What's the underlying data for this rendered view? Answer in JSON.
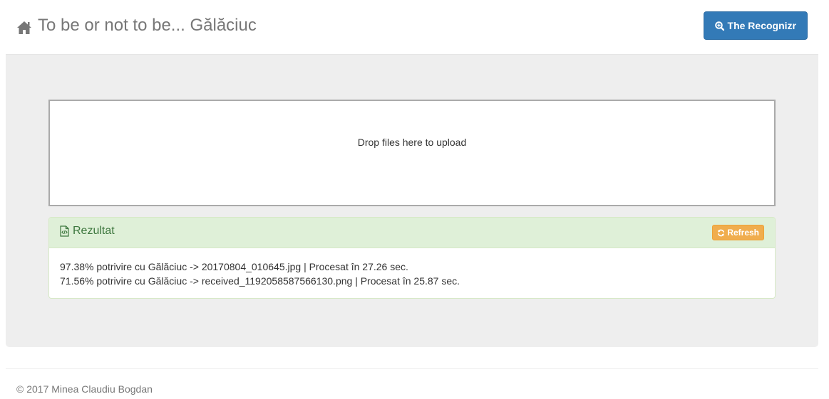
{
  "navbar": {
    "brand_icon": "home-icon",
    "brand_text": "To be or not to be... Gălăciuc",
    "button_icon": "zoom-in-icon",
    "button_label": "The Recognizr",
    "button_color": "#337ab7"
  },
  "dropzone": {
    "message": "Drop files here to upload"
  },
  "results_panel": {
    "title_icon": "code-file-icon",
    "title": "Rezultat",
    "refresh_icon": "refresh-icon",
    "refresh_label": "Refresh",
    "refresh_color": "#f0ad4e",
    "heading_color": "#dff0d8",
    "lines": [
      "97.38% potrivire cu Gălăciuc -> 20170804_010645.jpg | Procesat în 27.26 sec.",
      "71.56% potrivire cu Gălăciuc -> received_1192058587566130.png | Procesat în 25.87 sec."
    ]
  },
  "footer": {
    "text": "© 2017 Minea Claudiu Bogdan"
  }
}
